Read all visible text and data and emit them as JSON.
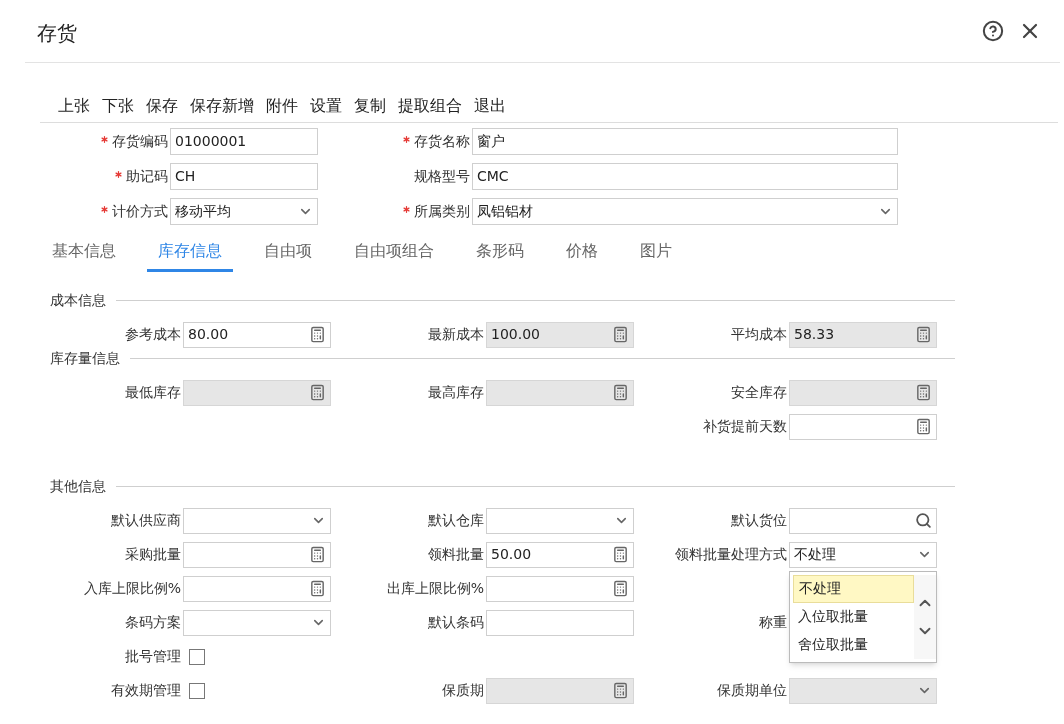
{
  "window": {
    "title": "存货"
  },
  "toolbar": [
    "上张",
    "下张",
    "保存",
    "保存新增",
    "附件",
    "设置",
    "复制",
    "提取组合",
    "退出"
  ],
  "header_rows": [
    [
      {
        "label": "存货编码",
        "required": true,
        "kind": "text",
        "value": "01000001"
      },
      {
        "label": "存货名称",
        "required": true,
        "kind": "text",
        "value": "窗户"
      }
    ],
    [
      {
        "label": "助记码",
        "required": true,
        "kind": "text",
        "value": "CH"
      },
      {
        "label": "规格型号",
        "required": false,
        "kind": "text",
        "value": "CMC"
      }
    ],
    [
      {
        "label": "计价方式",
        "required": true,
        "kind": "select",
        "value": "移动平均"
      },
      {
        "label": "所属类别",
        "required": true,
        "kind": "select",
        "value": "凤铝铝材"
      }
    ]
  ],
  "tabs": [
    {
      "label": "基本信息",
      "selected": false
    },
    {
      "label": "库存信息",
      "selected": true
    },
    {
      "label": "自由项",
      "selected": false
    },
    {
      "label": "自由项组合",
      "selected": false
    },
    {
      "label": "条形码",
      "selected": false
    },
    {
      "label": "价格",
      "selected": false
    },
    {
      "label": "图片",
      "selected": false
    }
  ],
  "sections": [
    {
      "title": "成本信息",
      "rows": [
        [
          {
            "label": "参考成本",
            "kind": "calc",
            "value": "80.00",
            "disabled": false
          },
          {
            "label": "最新成本",
            "kind": "calc",
            "value": "100.00",
            "disabled": true
          },
          {
            "label": "平均成本",
            "kind": "calc",
            "value": "58.33",
            "disabled": true
          }
        ]
      ]
    },
    {
      "title": "库存量信息",
      "rows": [
        [
          {
            "label": "最低库存",
            "kind": "calc",
            "disabled": true
          },
          {
            "label": "最高库存",
            "kind": "calc",
            "disabled": true
          },
          {
            "label": "安全库存",
            "kind": "calc",
            "disabled": true
          }
        ],
        [
          null,
          null,
          {
            "label": "补货提前天数",
            "kind": "calc",
            "disabled": false
          }
        ]
      ]
    },
    {
      "title": "其他信息",
      "rows": [
        [
          {
            "label": "默认供应商",
            "kind": "select",
            "disabled": false
          },
          {
            "label": "默认仓库",
            "kind": "select",
            "disabled": false
          },
          {
            "label": "默认货位",
            "kind": "search",
            "disabled": false
          }
        ],
        [
          {
            "label": "采购批量",
            "kind": "calc",
            "disabled": false
          },
          {
            "label": "领料批量",
            "kind": "calc",
            "value": "50.00",
            "disabled": false
          },
          {
            "label": "领料批量处理方式",
            "kind": "select",
            "value": "不处理",
            "disabled": false,
            "options": [
              {
                "label": "不处理",
                "selected": true
              },
              {
                "label": "入位取批量",
                "selected": false
              },
              {
                "label": "舍位取批量",
                "selected": false
              }
            ]
          }
        ],
        [
          {
            "label": "入库上限比例%",
            "kind": "calc",
            "disabled": false
          },
          {
            "label": "出库上限比例%",
            "kind": "calc",
            "disabled": false
          },
          null
        ],
        [
          {
            "label": "条码方案",
            "kind": "select",
            "disabled": false
          },
          {
            "label": "默认条码",
            "kind": "text",
            "disabled": false
          },
          {
            "label": "称重",
            "kind": "hidden"
          }
        ],
        [
          {
            "label": "批号管理",
            "kind": "checkbox",
            "checked": false
          },
          null,
          null
        ],
        [
          {
            "label": "有效期管理",
            "kind": "checkbox",
            "checked": false
          },
          {
            "label": "保质期",
            "kind": "calc",
            "disabled": true
          },
          {
            "label": "保质期单位",
            "kind": "select",
            "disabled": true
          }
        ]
      ]
    }
  ]
}
